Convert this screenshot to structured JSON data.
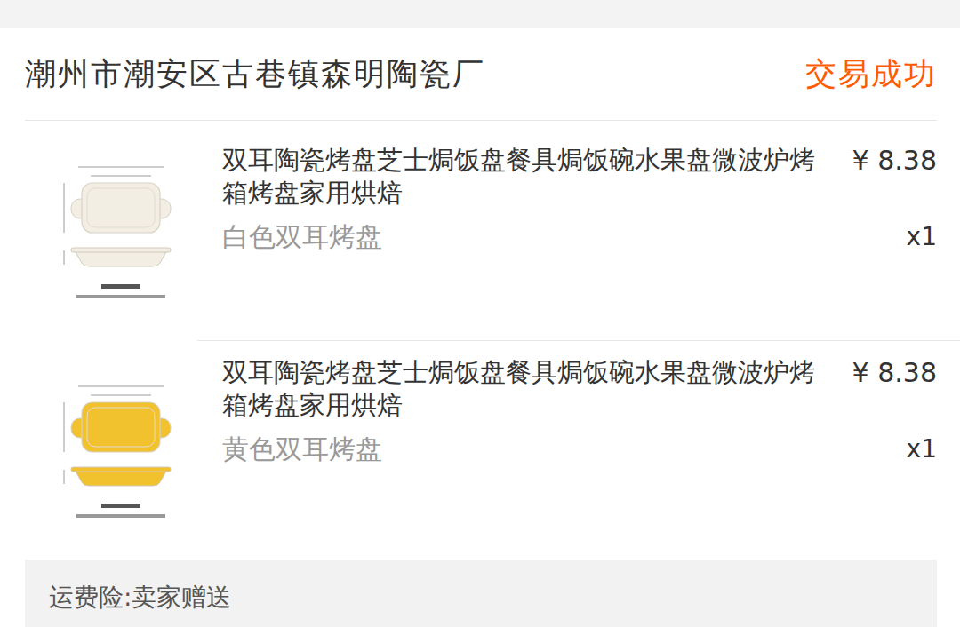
{
  "store": {
    "name": "潮州市潮安区古巷镇森明陶瓷厂",
    "status": "交易成功"
  },
  "items": [
    {
      "title": "双耳陶瓷烤盘芝士焗饭盘餐具焗饭碗水果盘微波炉烤箱烤盘家用烘焙",
      "price": "¥ 8.38",
      "variant": "白色双耳烤盘",
      "quantity": "x1",
      "color": "#f3eee3"
    },
    {
      "title": "双耳陶瓷烤盘芝士焗饭盘餐具焗饭碗水果盘微波炉烤箱烤盘家用烘焙",
      "price": "¥ 8.38",
      "variant": "黄色双耳烤盘",
      "quantity": "x1",
      "color": "#f2c12e"
    }
  ],
  "footer": {
    "shipping_insurance": "运费险:卖家赠送"
  }
}
